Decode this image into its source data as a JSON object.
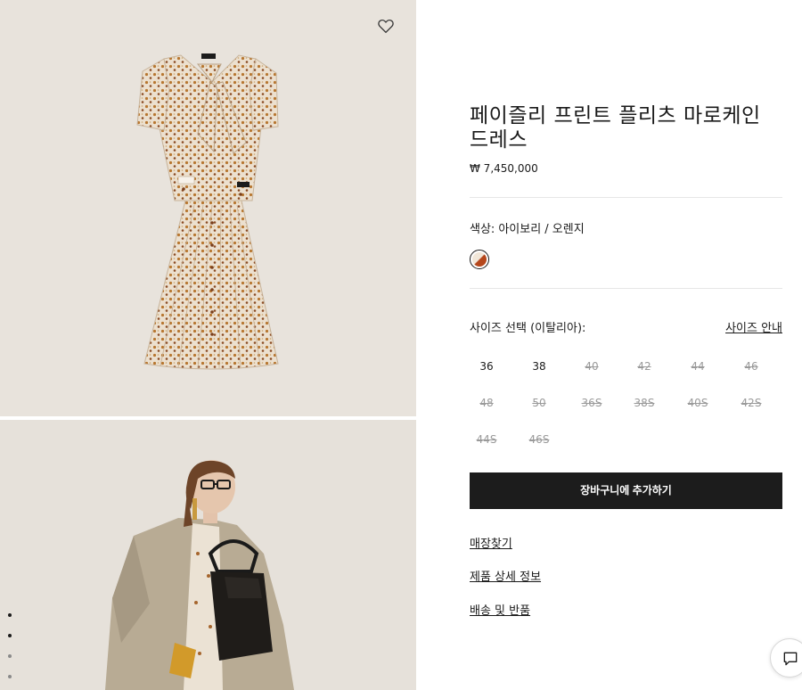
{
  "product": {
    "title": "페이즐리 프린트 플리츠 마로케인 드레스",
    "price": "₩ 7,450,000"
  },
  "color": {
    "label": "색상:",
    "value": "아이보리 / 오렌지",
    "swatch_colors": [
      "#f1e7d9",
      "#b5471c"
    ]
  },
  "size": {
    "label": "사이즈 선택 (이탈리아):",
    "guide_label": "사이즈 안내",
    "options": [
      {
        "label": "36",
        "available": true
      },
      {
        "label": "38",
        "available": true
      },
      {
        "label": "40",
        "available": false
      },
      {
        "label": "42",
        "available": false
      },
      {
        "label": "44",
        "available": false
      },
      {
        "label": "46",
        "available": false
      },
      {
        "label": "48",
        "available": false
      },
      {
        "label": "50",
        "available": false
      },
      {
        "label": "36S",
        "available": false
      },
      {
        "label": "38S",
        "available": false
      },
      {
        "label": "40S",
        "available": false
      },
      {
        "label": "42S",
        "available": false
      },
      {
        "label": "44S",
        "available": false
      },
      {
        "label": "46S",
        "available": false
      }
    ]
  },
  "actions": {
    "add_to_cart": "장바구니에 추가하기"
  },
  "links": {
    "store_finder": "매장찾기",
    "product_details": "제품 상세 정보",
    "shipping_returns": "배송 및 반품"
  },
  "icons": {
    "wishlist": "heart-icon",
    "chat": "chat-icon"
  },
  "gallery": {
    "image_count": 4,
    "active_index": 1
  }
}
